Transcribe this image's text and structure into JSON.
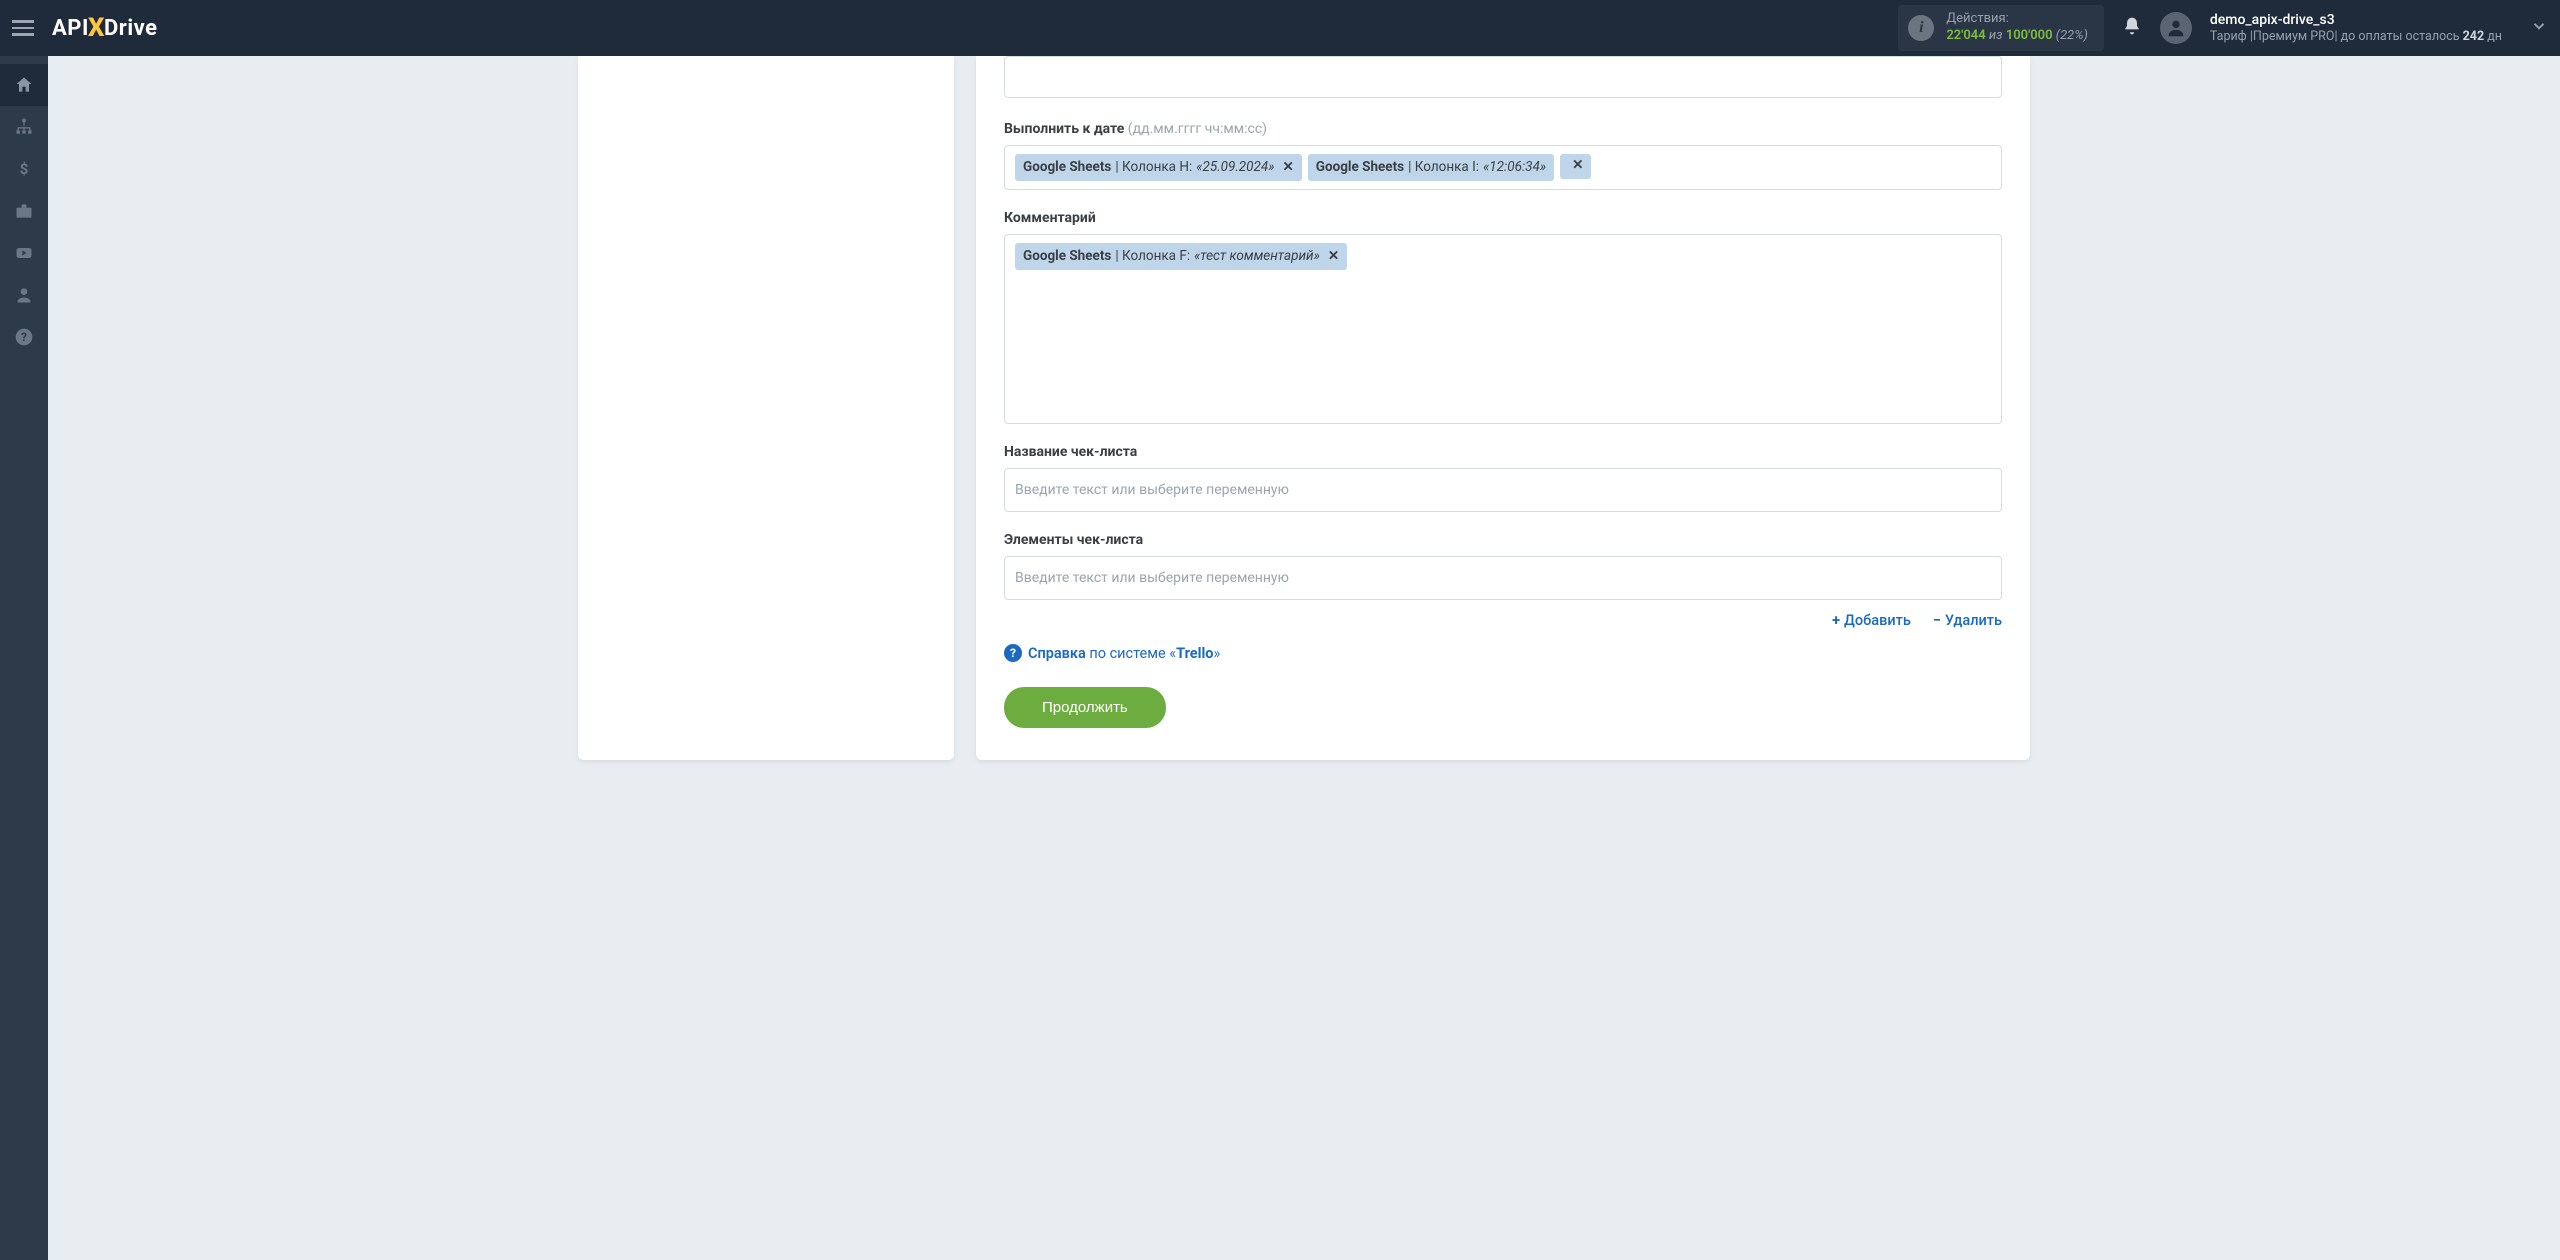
{
  "header": {
    "logo": {
      "pre": "API",
      "x": "X",
      "post": "Drive"
    },
    "actions": {
      "label": "Действия:",
      "current": "22'044",
      "separator": "из",
      "limit": "100'000",
      "percent": "(22%)"
    },
    "user": {
      "name": "demo_apix-drive_s3",
      "tariff_prefix": "Тариф |",
      "tariff_name": "Премиум PRO",
      "tariff_sep": "| до оплаты осталось ",
      "days": "242",
      "days_suffix": " дн"
    }
  },
  "sidebar": {
    "items": [
      {
        "name": "home-icon"
      },
      {
        "name": "connections-icon"
      },
      {
        "name": "billing-icon"
      },
      {
        "name": "briefcase-icon"
      },
      {
        "name": "youtube-icon"
      },
      {
        "name": "profile-icon"
      },
      {
        "name": "help-icon"
      }
    ]
  },
  "fields": {
    "due_date": {
      "label": "Выполнить к дате",
      "hint": "(дд.мм.гггг чч:мм:сс)",
      "chips": [
        {
          "source": "Google Sheets",
          "column": " | Колонка H: ",
          "value": "«25.09.2024»"
        },
        {
          "source": "Google Sheets",
          "column": " | Колонка I: ",
          "value": "«12:06:34»"
        }
      ]
    },
    "comment": {
      "label": "Комментарий",
      "chips": [
        {
          "source": "Google Sheets",
          "column": " | Колонка F: ",
          "value": "«тест комментарий»"
        }
      ]
    },
    "checklist_name": {
      "label": "Название чек-листа",
      "placeholder": "Введите текст или выберите переменную"
    },
    "checklist_items": {
      "label": "Элементы чек-листа",
      "placeholder": "Введите текст или выберите переменную"
    }
  },
  "actions": {
    "add": "Добавить",
    "remove": "Удалить"
  },
  "help": {
    "link": "Справка",
    "text": " по системе «",
    "system": "Trello",
    "close": "»"
  },
  "buttons": {
    "continue": "Продолжить"
  }
}
